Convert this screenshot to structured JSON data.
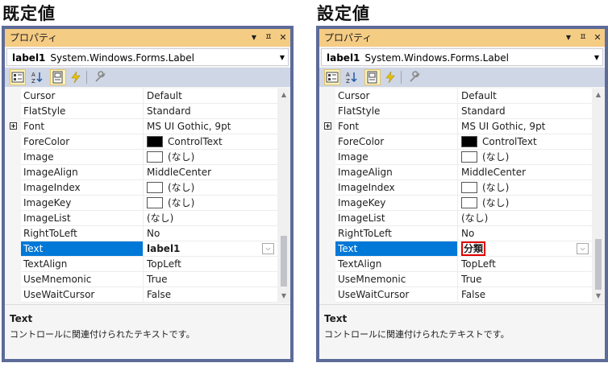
{
  "captions": {
    "left": "既定値",
    "right": "設定値"
  },
  "panel": {
    "title": "プロパティ",
    "object_name": "label1",
    "object_type": "System.Windows.Forms.Label",
    "description_title": "Text",
    "description_text": "コントロールに関連付けられたテキストです。"
  },
  "icons": {
    "titlebar": [
      "chevron-down-icon",
      "pin-icon",
      "close-icon"
    ],
    "toolbar": [
      "categorized-icon",
      "alphabetical-icon",
      "properties-icon",
      "events-icon",
      "property-pages-icon"
    ]
  },
  "rows": [
    {
      "name": "Cursor",
      "value": "Default"
    },
    {
      "name": "FlatStyle",
      "value": "Standard"
    },
    {
      "name": "Font",
      "value": "MS UI Gothic, 9pt"
    },
    {
      "name": "ForeColor",
      "value": "ControlText"
    },
    {
      "name": "Image",
      "value": "(なし)"
    },
    {
      "name": "ImageAlign",
      "value": "MiddleCenter"
    },
    {
      "name": "ImageIndex",
      "value": "(なし)"
    },
    {
      "name": "ImageKey",
      "value": "(なし)"
    },
    {
      "name": "ImageList",
      "value": "(なし)"
    },
    {
      "name": "RightToLeft",
      "value": "No"
    },
    {
      "name": "Text",
      "value": "label1"
    },
    {
      "name": "TextAlign",
      "value": "TopLeft"
    },
    {
      "name": "UseMnemonic",
      "value": "True"
    },
    {
      "name": "UseWaitCursor",
      "value": "False"
    }
  ],
  "text_value_set": "分類",
  "colors": {
    "selection": "#0078d7",
    "titlebar": "#f5cc84",
    "highlight_border": "#e00000",
    "frame": "#5d6b99"
  }
}
